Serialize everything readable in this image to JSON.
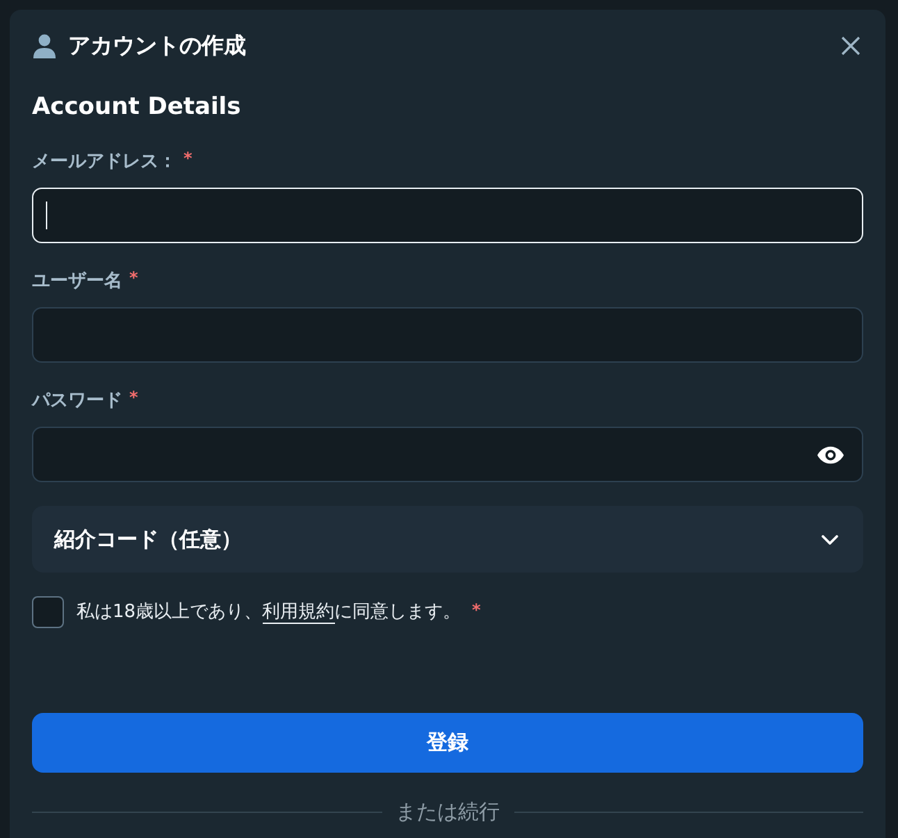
{
  "dialog": {
    "title": "アカウントの作成",
    "section_title": "Account Details"
  },
  "fields": [
    {
      "kind": "email",
      "label": "メールアドレス：",
      "required_mark": "*",
      "focused": true
    },
    {
      "kind": "text",
      "label": "ユーザー名",
      "required_mark": "*",
      "focused": false
    },
    {
      "kind": "password",
      "label": "パスワード",
      "required_mark": "*",
      "focused": false
    }
  ],
  "referral": {
    "label": "紹介コード（任意）",
    "expanded": false
  },
  "consent": {
    "checked": false,
    "text_before": "私は18歳以上であり、",
    "link": "利用規約",
    "text_after": "に同意します。",
    "required_mark": "*"
  },
  "submit_button": "登録",
  "divider": "または続行"
}
